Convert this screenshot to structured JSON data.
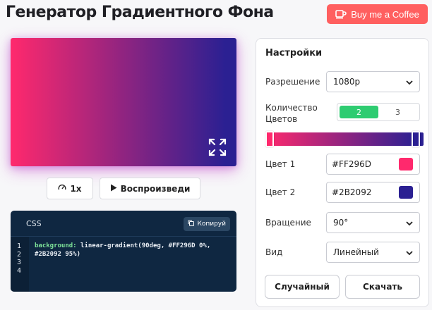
{
  "header": {
    "title": "Генератор Градиентного Фона",
    "coffee_label": "Buy me a Coffee"
  },
  "preview": {
    "color_start": "#FF296D",
    "color_end": "#2B2092",
    "rotation_deg": 90
  },
  "controls": {
    "speed_label": "1x",
    "play_label": "Воспроизведи"
  },
  "code": {
    "title": "CSS",
    "copy_label": "Копируй",
    "line_numbers": "1\n2\n3\n4",
    "property": "background:",
    "value": " linear-gradient(90deg, #FF296D 0%,\n#2B2092 95%)"
  },
  "settings": {
    "title": "Настройки",
    "resolution_label": "Разрешение",
    "resolution_value": "1080p",
    "colors_count_label": "Количество Цветов",
    "colors_count_options": [
      "2",
      "3"
    ],
    "colors_count_selected": "2",
    "color1_label": "Цвет 1",
    "color1_value": "#FF296D",
    "color2_label": "Цвет 2",
    "color2_value": "#2B2092",
    "rotation_label": "Вращение",
    "rotation_value": "90°",
    "type_label": "Вид",
    "type_value": "Линейный",
    "random_label": "Случайный",
    "download_label": "Скачать",
    "stop1_fraction": 0.0,
    "stop2_fraction": 0.95
  },
  "colors": {
    "accent_green": "#2ecc71",
    "coffee_red": "#ff5f5f",
    "code_bg": "#0f2741"
  }
}
